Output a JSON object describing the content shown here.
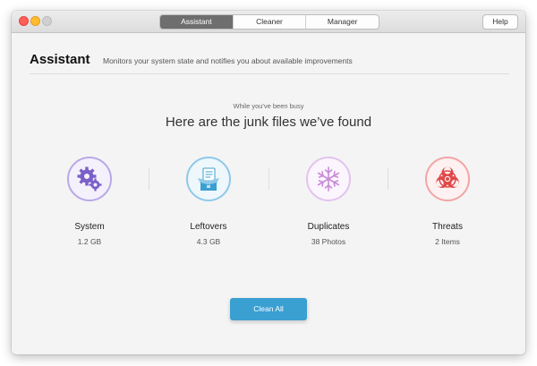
{
  "tabs": [
    {
      "label": "Assistant"
    },
    {
      "label": "Cleaner"
    },
    {
      "label": "Manager"
    }
  ],
  "help_label": "Help",
  "header": {
    "title": "Assistant",
    "subtitle": "Monitors your system state and notifies you about available improvements"
  },
  "summary": {
    "eyebrow": "While you've been busy",
    "headline": "Here are the junk files we’ve found"
  },
  "categories": [
    {
      "label": "System",
      "value": "1.2 GB",
      "icon": "gear-icon",
      "color": "#7b5fc8"
    },
    {
      "label": "Leftovers",
      "value": "4.3 GB",
      "icon": "open-box-icon",
      "color": "#3a9fd1"
    },
    {
      "label": "Duplicates",
      "value": "38 Photos",
      "icon": "snowflake-icon",
      "color": "#c88ad8"
    },
    {
      "label": "Threats",
      "value": "2 Items",
      "icon": "biohazard-icon",
      "color": "#e04848"
    }
  ],
  "action": {
    "label": "Clean All"
  }
}
